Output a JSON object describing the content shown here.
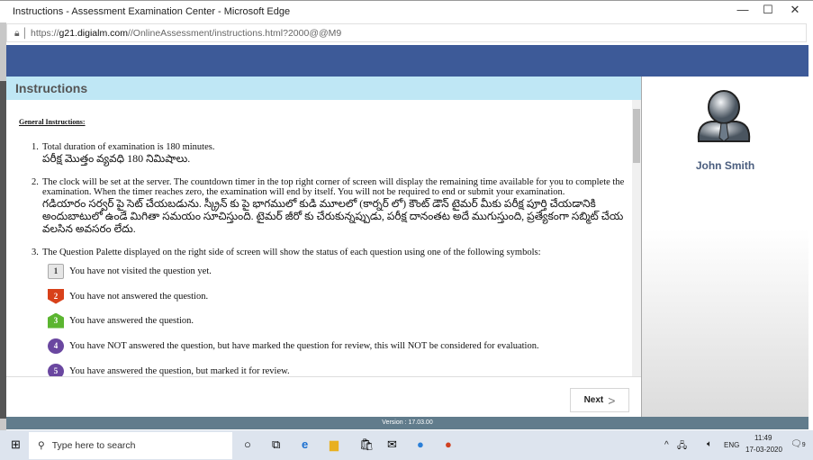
{
  "window": {
    "title": "Instructions - Assessment Examination Center - Microsoft Edge",
    "url_prefix": "https://",
    "url_domain": "g21.digialm.com",
    "url_path": "//OnlineAssessment/instructions.html?2000@@M9"
  },
  "page": {
    "heading": "Instructions",
    "general_label": "General Instructions:",
    "items": [
      {
        "num": "1.",
        "en": "Total duration of examination is 180 minutes.",
        "te": "పరీక్ష మొత్తం వ్యవధి 180 నిమిషాలు."
      },
      {
        "num": "2.",
        "en": "The clock will be set at the server. The countdown timer in the top right corner of screen will display the remaining time available for you to complete the examination. When the timer reaches zero, the examination will end by itself. You will not be required to end or submit your examination.",
        "te": "గడియారం సర్వర్ పై సెట్ చేయబడును. స్క్రీన్ కు పై భాగములో కుడి మూలలో (కార్నర్ లో) కౌంట్ డౌన్ టైమర్ మీకు పరీక్ష పూర్తి చేయడానికి అందుబాటులో ఉండే మిగితా సమయం సూచిస్తుంది. టైమర్ జీరో కు చేరుకున్నప్పుడు, పరీక్ష దానంతట అదే ముగుస్తుంది, ప్రత్యేకంగా సబ్మిట్ చేయ వలసిన అవసరం లేదు."
      },
      {
        "num": "3.",
        "en": "The Question Palette displayed on the right side of screen will show the status of each question using one of the following symbols:"
      }
    ],
    "symbols": [
      {
        "n": "1",
        "text": "You have not visited the question yet.",
        "color": "#e6e6e6"
      },
      {
        "n": "2",
        "text": "You have not answered the question.",
        "color": "#d8411a"
      },
      {
        "n": "3",
        "text": "You have answered the question.",
        "color": "#5bb530"
      },
      {
        "n": "4",
        "text": "You have NOT answered the question, but have marked the question for review, this will NOT be considered for evaluation.",
        "color": "#6a47a0"
      },
      {
        "n": "5",
        "text": "You have answered the question, but marked it for review.",
        "color": "#6a47a0"
      }
    ],
    "next_label": "Next",
    "version": "Version : 17.03.00"
  },
  "user": {
    "name": "John Smith"
  },
  "taskbar": {
    "search_placeholder": "Type here to search",
    "time": "11:49",
    "date": "17-03-2020",
    "lang": "ENG",
    "notifications": "9"
  },
  "colors": {
    "header": "#3d5a98",
    "instructions_bar": "#bfe7f5",
    "footer": "#617c8c"
  }
}
